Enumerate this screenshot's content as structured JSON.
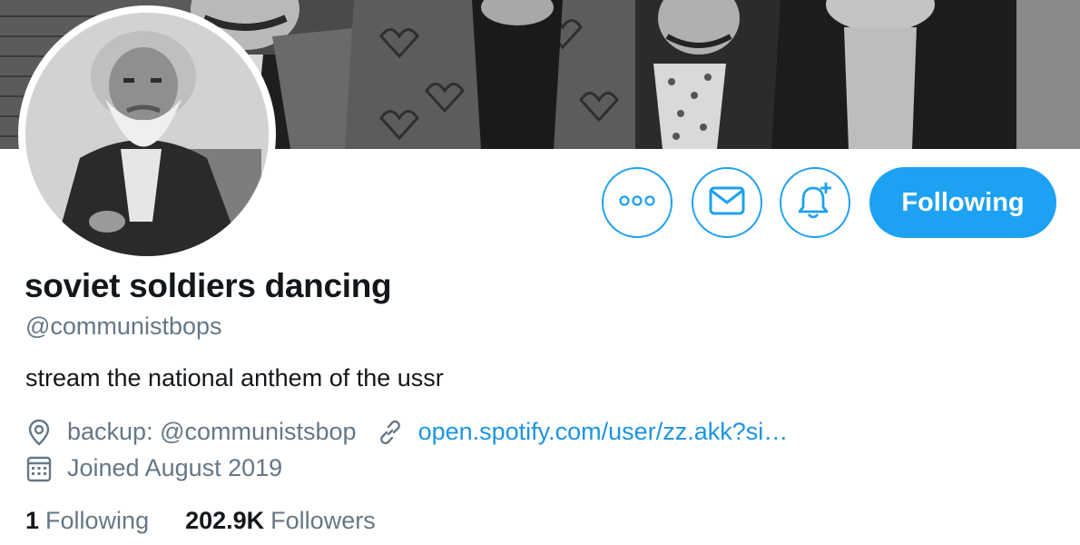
{
  "profile": {
    "display_name": "soviet soldiers dancing",
    "handle": "@communistbops",
    "bio": "stream the national anthem of the ussr",
    "location": "backup: @communistsbop",
    "website": "open.spotify.com/user/zz.akk?si…",
    "joined": "Joined August 2019"
  },
  "stats": {
    "following_count": "1",
    "following_label": "Following",
    "followers_count": "202.9K",
    "followers_label": "Followers"
  },
  "actions": {
    "following_button": "Following"
  },
  "icons": {
    "more": "more-dots-icon",
    "message": "envelope-icon",
    "notify": "bell-plus-icon",
    "location": "location-pin-icon",
    "link": "link-icon",
    "calendar": "calendar-icon"
  },
  "colors": {
    "accent": "#1da1f2",
    "link": "#1b95e0",
    "secondary_text": "#657786",
    "primary_text": "#14171a"
  }
}
